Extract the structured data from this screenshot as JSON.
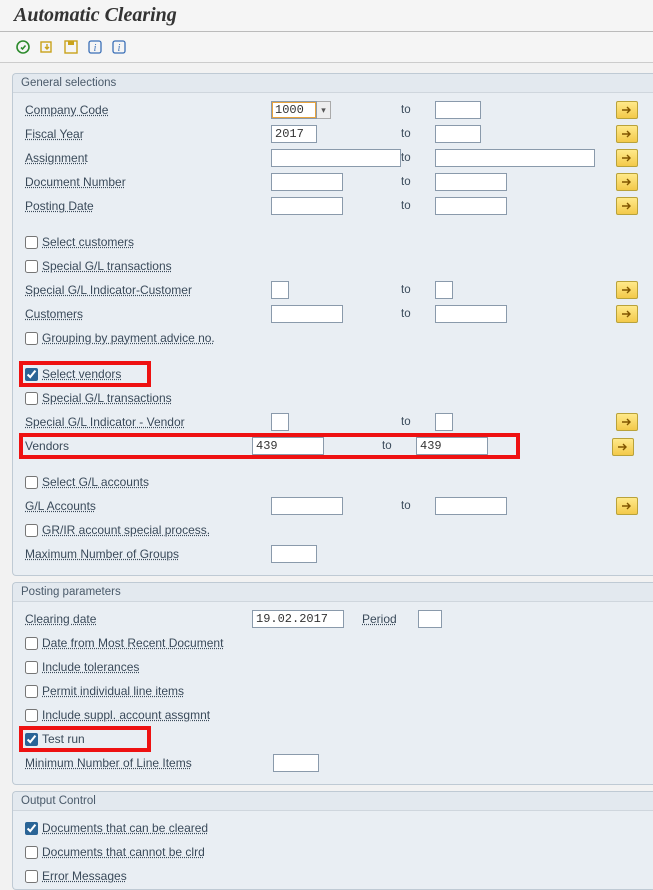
{
  "title": "Automatic Clearing",
  "group1": {
    "title": "General selections",
    "company_code_lbl": "Company Code",
    "company_code_from": "1000",
    "company_code_to": "",
    "fiscal_year_lbl": "Fiscal Year",
    "fiscal_year_from": "2017",
    "fiscal_year_to": "",
    "assignment_lbl": "Assignment",
    "assignment_from": "",
    "assignment_to": "",
    "docnum_lbl": "Document Number",
    "docnum_from": "",
    "docnum_to": "",
    "posting_date_lbl": "Posting Date",
    "posting_date_from": "",
    "posting_date_to": "",
    "to_label": "to",
    "select_customers_lbl": "Select customers",
    "special_gl_trans1_lbl": "Special G/L transactions",
    "special_gl_ind_cust_lbl": "Special G/L Indicator-Customer",
    "special_gl_ind_cust_from": "",
    "special_gl_ind_cust_to": "",
    "customers_lbl": "Customers",
    "customers_from": "",
    "customers_to": "",
    "grouping_lbl": "Grouping by payment advice no.",
    "select_vendors_lbl": "Select vendors",
    "special_gl_trans2_lbl": "Special G/L transactions",
    "special_gl_ind_vend_lbl": "Special G/L Indicator - Vendor",
    "special_gl_ind_vend_from": "",
    "special_gl_ind_vend_to": "",
    "vendors_lbl": "Vendors",
    "vendors_from": "439",
    "vendors_to": "439",
    "select_gl_lbl": "Select G/L accounts",
    "gl_accounts_lbl": "G/L Accounts",
    "gl_accounts_from": "",
    "gl_accounts_to": "",
    "grir_lbl": "GR/IR account special process.",
    "max_groups_lbl": "Maximum Number of Groups",
    "max_groups_val": ""
  },
  "group2": {
    "title": "Posting parameters",
    "clearing_date_lbl": "Clearing date",
    "clearing_date_val": "19.02.2017",
    "period_lbl": "Period",
    "period_val": "",
    "date_recent_lbl": "Date from Most Recent Document",
    "include_tol_lbl": "Include tolerances",
    "permit_items_lbl": "Permit individual line items",
    "include_suppl_lbl": "Include suppl. account assgmnt",
    "test_run_lbl": "Test run",
    "min_line_items_lbl": "Minimum Number of Line Items",
    "min_line_items_val": ""
  },
  "group3": {
    "title": "Output Control",
    "docs_clear_lbl": "Documents that can be cleared",
    "docs_not_clear_lbl": "Documents that cannot be clrd",
    "error_msg_lbl": "Error Messages"
  },
  "icons": {
    "execute": "execute-icon",
    "variant_get": "variant-get-icon",
    "variant_save": "variant-save-icon",
    "info1": "info-icon",
    "info2": "info-icon",
    "multi_select": "multi-select-icon"
  }
}
